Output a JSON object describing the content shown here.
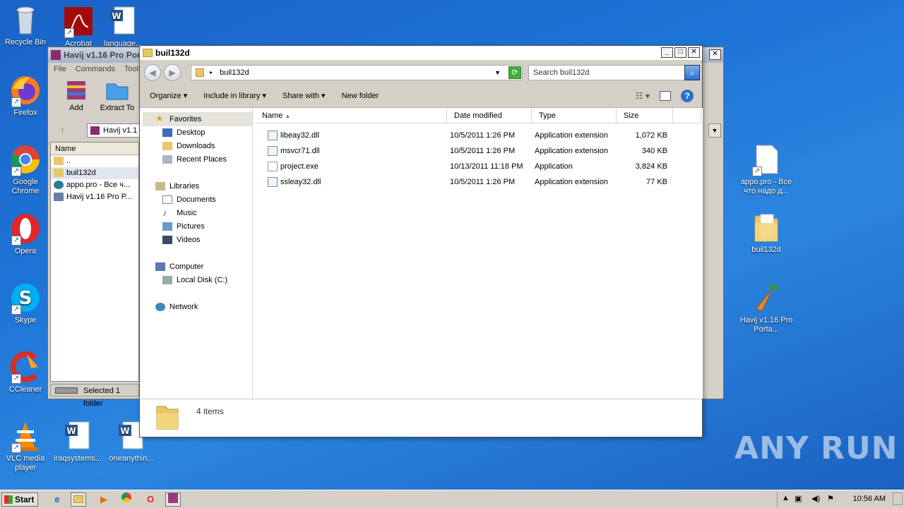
{
  "desktop": {
    "left_icons": [
      {
        "label": "Recycle Bin"
      },
      {
        "label": "Firefox"
      },
      {
        "label": "Google Chrome"
      },
      {
        "label": "Opera"
      },
      {
        "label": "Skype"
      },
      {
        "label": "CCleaner"
      },
      {
        "label": "VLC media player"
      }
    ],
    "top_icons": [
      {
        "label": "Acrobat"
      },
      {
        "label": "language..."
      }
    ],
    "bottom_icons": [
      {
        "label": "iraqsystems..."
      },
      {
        "label": "oneanythin..."
      }
    ],
    "right_icons": [
      {
        "label": "appo.pro - Все что надо д..."
      },
      {
        "label": "buil132d"
      },
      {
        "label": "Havij v1.16 Pro Porta..."
      }
    ]
  },
  "rar_window": {
    "title": "Havij v1.16 Pro Por",
    "menu": [
      "File",
      "Commands",
      "Tools"
    ],
    "tools": [
      {
        "label": "Add"
      },
      {
        "label": "Extract To"
      }
    ],
    "path": "Havij v1.1",
    "column": "Name",
    "rows": [
      "..",
      "buil132d",
      "appo.pro - Все ч...",
      "Havij v1.16 Pro P..."
    ],
    "status": "Selected 1 folder"
  },
  "explorer": {
    "title": "buil132d",
    "address": "buil132d",
    "search_placeholder": "Search buil132d",
    "commands": [
      "Organize",
      "Include in library",
      "Share with",
      "New folder"
    ],
    "nav": {
      "favorites": "Favorites",
      "desktop": "Desktop",
      "downloads": "Downloads",
      "recent": "Recent Places",
      "libraries": "Libraries",
      "documents": "Documents",
      "music": "Music",
      "pictures": "Pictures",
      "videos": "Videos",
      "computer": "Computer",
      "local_disk": "Local Disk (C:)",
      "network": "Network"
    },
    "columns": {
      "name": "Name",
      "date": "Date modified",
      "type": "Type",
      "size": "Size"
    },
    "files": [
      {
        "name": "libeay32.dll",
        "date": "10/5/2011 1:26 PM",
        "type": "Application extension",
        "size": "1,072 KB"
      },
      {
        "name": "msvcr71.dll",
        "date": "10/5/2011 1:26 PM",
        "type": "Application extension",
        "size": "340 KB"
      },
      {
        "name": "project.exe",
        "date": "10/13/2011 11:18 PM",
        "type": "Application",
        "size": "3,824 KB"
      },
      {
        "name": "ssleay32.dll",
        "date": "10/5/2011 1:26 PM",
        "type": "Application extension",
        "size": "77 KB"
      }
    ],
    "item_count": "4 items"
  },
  "taskbar": {
    "start": "Start",
    "clock": "10:56 AM"
  },
  "watermark": "ANY RUN"
}
